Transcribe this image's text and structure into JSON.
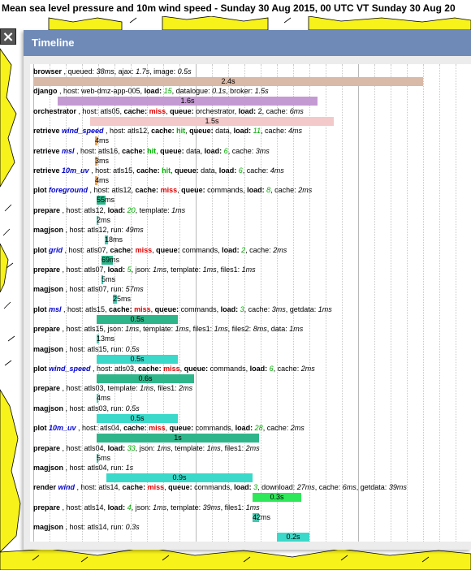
{
  "window_title": "Mean sea level pressure and 10m wind speed - Sunday 30 Aug 2015, 00 UTC VT Sunday 30 Aug 20",
  "close_label": "×",
  "panel": {
    "title": "Timeline"
  },
  "colors": {
    "header": "#6f8ab7",
    "browser_bar": "#d9b9a7",
    "django_bar": "#c49ad3",
    "orchestrator_bar": "#f4c9c9",
    "retrieve_bar": "#e8a35a",
    "plot_bar": "#2fb58a",
    "small_bar": "#45c9b0",
    "magjson_bar": "#3ad9c9",
    "render_bar": "#2ee85a",
    "miss": "#e00000",
    "hit": "#00b000",
    "name": "#0000cc"
  },
  "rows": [
    {
      "parts": [
        [
          "b",
          "browser"
        ],
        [
          "t",
          " ,  queued: "
        ],
        [
          "i",
          "38ms"
        ],
        [
          "t",
          ",  ajax: "
        ],
        [
          "i",
          "1.7s"
        ],
        [
          "t",
          ",  image: "
        ],
        [
          "i",
          "0.5s"
        ]
      ],
      "bar": {
        "start": 0.0,
        "dur": 2.4,
        "color": "browser_bar",
        "label": "2.4s"
      }
    },
    {
      "parts": [
        [
          "b",
          "django"
        ],
        [
          "t",
          " ,  host: web-dmz-app-005,  "
        ],
        [
          "b",
          "load: "
        ],
        [
          "l",
          "15"
        ],
        [
          "t",
          ",  datalogue: "
        ],
        [
          "i",
          "0.1s"
        ],
        [
          "t",
          ",  broker: "
        ],
        [
          "i",
          "1.5s"
        ]
      ],
      "bar": {
        "start": 0.15,
        "dur": 1.6,
        "color": "django_bar",
        "label": "1.6s"
      }
    },
    {
      "parts": [
        [
          "b",
          "orchestrator"
        ],
        [
          "t",
          " ,  host: atls05,  "
        ],
        [
          "b",
          "cache: "
        ],
        [
          "m",
          "miss"
        ],
        [
          "t",
          ",  "
        ],
        [
          "b",
          "queue: "
        ],
        [
          "t",
          "orchestrator,  "
        ],
        [
          "b",
          "load: "
        ],
        [
          "t",
          "2,  cache: "
        ],
        [
          "i",
          "6ms"
        ]
      ],
      "bar": {
        "start": 0.35,
        "dur": 1.5,
        "color": "orchestrator_bar",
        "label": "1.5s"
      }
    },
    {
      "parts": [
        [
          "b",
          "retrieve "
        ],
        [
          "n",
          "wind_speed"
        ],
        [
          "t",
          " ,  host: atls12,  "
        ],
        [
          "b",
          "cache: "
        ],
        [
          "h",
          "hit"
        ],
        [
          "t",
          ",  "
        ],
        [
          "b",
          "queue: "
        ],
        [
          "t",
          "data,  "
        ],
        [
          "b",
          "load: "
        ],
        [
          "l",
          "11"
        ],
        [
          "t",
          ",  cache: "
        ],
        [
          "i",
          "4ms"
        ]
      ],
      "bar": {
        "start": 0.38,
        "dur": 0.015,
        "color": "retrieve_bar",
        "label": "4ms"
      }
    },
    {
      "parts": [
        [
          "b",
          "retrieve "
        ],
        [
          "n",
          "msl"
        ],
        [
          "t",
          " ,  host: atls16,  "
        ],
        [
          "b",
          "cache: "
        ],
        [
          "h",
          "hit"
        ],
        [
          "t",
          ",  "
        ],
        [
          "b",
          "queue: "
        ],
        [
          "t",
          "data,  "
        ],
        [
          "b",
          "load: "
        ],
        [
          "l",
          "6"
        ],
        [
          "t",
          ",  cache: "
        ],
        [
          "i",
          "3ms"
        ]
      ],
      "bar": {
        "start": 0.38,
        "dur": 0.015,
        "color": "retrieve_bar",
        "label": "3ms"
      }
    },
    {
      "parts": [
        [
          "b",
          "retrieve "
        ],
        [
          "n",
          "10m_uv"
        ],
        [
          "t",
          " ,  host: atls15,  "
        ],
        [
          "b",
          "cache: "
        ],
        [
          "h",
          "hit"
        ],
        [
          "t",
          ",  "
        ],
        [
          "b",
          "queue: "
        ],
        [
          "t",
          "data,  "
        ],
        [
          "b",
          "load: "
        ],
        [
          "l",
          "6"
        ],
        [
          "t",
          ",  cache: "
        ],
        [
          "i",
          "4ms"
        ]
      ],
      "bar": {
        "start": 0.38,
        "dur": 0.015,
        "color": "retrieve_bar",
        "label": "4ms"
      }
    },
    {
      "parts": [
        [
          "b",
          "plot "
        ],
        [
          "n",
          "foreground"
        ],
        [
          "t",
          " ,  host: atls12,  "
        ],
        [
          "b",
          "cache: "
        ],
        [
          "m",
          "miss"
        ],
        [
          "t",
          ",  "
        ],
        [
          "b",
          "queue: "
        ],
        [
          "t",
          "commands,  "
        ],
        [
          "b",
          "load: "
        ],
        [
          "l",
          "8"
        ],
        [
          "t",
          ",  cache: "
        ],
        [
          "i",
          "2ms"
        ]
      ],
      "bar": {
        "start": 0.39,
        "dur": 0.055,
        "color": "plot_bar",
        "label": "55ms"
      }
    },
    {
      "parts": [
        [
          "b",
          "prepare"
        ],
        [
          "t",
          " ,  host: atls12,  "
        ],
        [
          "b",
          "load: "
        ],
        [
          "l",
          "20"
        ],
        [
          "t",
          ",  template: "
        ],
        [
          "i",
          "1ms"
        ]
      ],
      "bar": {
        "start": 0.39,
        "dur": 0.002,
        "color": "small_bar",
        "label": "2ms"
      }
    },
    {
      "parts": [
        [
          "b",
          "magjson"
        ],
        [
          "t",
          " ,  host: atls12,  run: "
        ],
        [
          "i",
          "49ms"
        ]
      ],
      "bar": {
        "start": 0.44,
        "dur": 0.018,
        "color": "small_bar",
        "label": "18ms"
      }
    },
    {
      "parts": [
        [
          "b",
          "plot "
        ],
        [
          "n",
          "grid"
        ],
        [
          "t",
          " ,  host: atls07,  "
        ],
        [
          "b",
          "cache: "
        ],
        [
          "m",
          "miss"
        ],
        [
          "t",
          ",  "
        ],
        [
          "b",
          "queue: "
        ],
        [
          "t",
          "commands,  "
        ],
        [
          "b",
          "load: "
        ],
        [
          "l",
          "2"
        ],
        [
          "t",
          ",  cache: "
        ],
        [
          "i",
          "2ms"
        ]
      ],
      "bar": {
        "start": 0.42,
        "dur": 0.069,
        "color": "plot_bar",
        "label": "69ms"
      }
    },
    {
      "parts": [
        [
          "b",
          "prepare"
        ],
        [
          "t",
          " ,  host: atls07,  "
        ],
        [
          "b",
          "load: "
        ],
        [
          "l",
          "5"
        ],
        [
          "t",
          ",  json: "
        ],
        [
          "i",
          "1ms"
        ],
        [
          "t",
          ",  template: "
        ],
        [
          "i",
          "1ms"
        ],
        [
          "t",
          ",  files1: "
        ],
        [
          "i",
          "1ms"
        ]
      ],
      "bar": {
        "start": 0.42,
        "dur": 0.005,
        "color": "small_bar",
        "label": "5ms"
      }
    },
    {
      "parts": [
        [
          "b",
          "magjson"
        ],
        [
          "t",
          " ,  host: atls07,  run: "
        ],
        [
          "i",
          "57ms"
        ]
      ],
      "bar": {
        "start": 0.49,
        "dur": 0.025,
        "color": "small_bar",
        "label": "25ms"
      }
    },
    {
      "parts": [
        [
          "b",
          "plot "
        ],
        [
          "n",
          "msl"
        ],
        [
          "t",
          " ,  host: atls15,  "
        ],
        [
          "b",
          "cache: "
        ],
        [
          "m",
          "miss"
        ],
        [
          "t",
          ",  "
        ],
        [
          "b",
          "queue: "
        ],
        [
          "t",
          "commands,  "
        ],
        [
          "b",
          "load: "
        ],
        [
          "l",
          "3"
        ],
        [
          "t",
          ",  cache: "
        ],
        [
          "i",
          "3ms"
        ],
        [
          "t",
          ",  getdata: "
        ],
        [
          "i",
          "1ms"
        ]
      ],
      "bar": {
        "start": 0.39,
        "dur": 0.5,
        "color": "plot_bar",
        "label": "0.5s"
      }
    },
    {
      "parts": [
        [
          "b",
          "prepare"
        ],
        [
          "t",
          " ,  host: atls15,  json: "
        ],
        [
          "i",
          "1ms"
        ],
        [
          "t",
          ",  template: "
        ],
        [
          "i",
          "1ms"
        ],
        [
          "t",
          ",  files1: "
        ],
        [
          "i",
          "1ms"
        ],
        [
          "t",
          ",  files2: "
        ],
        [
          "i",
          "8ms"
        ],
        [
          "t",
          ",  data: "
        ],
        [
          "i",
          "1ms"
        ]
      ],
      "bar": {
        "start": 0.39,
        "dur": 0.013,
        "color": "small_bar",
        "label": "13ms"
      }
    },
    {
      "parts": [
        [
          "b",
          "magjson"
        ],
        [
          "t",
          " ,  host: atls15,  run: "
        ],
        [
          "i",
          "0.5s"
        ]
      ],
      "bar": {
        "start": 0.39,
        "dur": 0.5,
        "color": "magjson_bar",
        "label": "0.5s"
      }
    },
    {
      "parts": [
        [
          "b",
          "plot "
        ],
        [
          "n",
          "wind_speed"
        ],
        [
          "t",
          " ,  host: atls03,  "
        ],
        [
          "b",
          "cache: "
        ],
        [
          "m",
          "miss"
        ],
        [
          "t",
          ",  "
        ],
        [
          "b",
          "queue: "
        ],
        [
          "t",
          "commands,  "
        ],
        [
          "b",
          "load: "
        ],
        [
          "l",
          "6"
        ],
        [
          "t",
          ",  cache: "
        ],
        [
          "i",
          "2ms"
        ]
      ],
      "bar": {
        "start": 0.39,
        "dur": 0.6,
        "color": "plot_bar",
        "label": "0.6s"
      }
    },
    {
      "parts": [
        [
          "b",
          "prepare"
        ],
        [
          "t",
          " ,  host: atls03,  template: "
        ],
        [
          "i",
          "1ms"
        ],
        [
          "t",
          ",  files1: "
        ],
        [
          "i",
          "2ms"
        ]
      ],
      "bar": {
        "start": 0.39,
        "dur": 0.004,
        "color": "small_bar",
        "label": "4ms"
      }
    },
    {
      "parts": [
        [
          "b",
          "magjson"
        ],
        [
          "t",
          " ,  host: atls03,  run: "
        ],
        [
          "i",
          "0.5s"
        ]
      ],
      "bar": {
        "start": 0.39,
        "dur": 0.5,
        "color": "magjson_bar",
        "label": "0.5s"
      }
    },
    {
      "parts": [
        [
          "b",
          "plot "
        ],
        [
          "n",
          "10m_uv"
        ],
        [
          "t",
          " ,  host: atls04,  "
        ],
        [
          "b",
          "cache: "
        ],
        [
          "m",
          "miss"
        ],
        [
          "t",
          ",  "
        ],
        [
          "b",
          "queue: "
        ],
        [
          "t",
          "commands,  "
        ],
        [
          "b",
          "load: "
        ],
        [
          "l",
          "28"
        ],
        [
          "t",
          ",  cache: "
        ],
        [
          "i",
          "2ms"
        ]
      ],
      "bar": {
        "start": 0.39,
        "dur": 1.0,
        "color": "plot_bar",
        "label": "1s"
      }
    },
    {
      "parts": [
        [
          "b",
          "prepare"
        ],
        [
          "t",
          " ,  host: atls04,  "
        ],
        [
          "b",
          "load: "
        ],
        [
          "l",
          "33"
        ],
        [
          "t",
          ",  json: "
        ],
        [
          "i",
          "1ms"
        ],
        [
          "t",
          ",  template: "
        ],
        [
          "i",
          "1ms"
        ],
        [
          "t",
          ",  files1: "
        ],
        [
          "i",
          "2ms"
        ]
      ],
      "bar": {
        "start": 0.39,
        "dur": 0.005,
        "color": "small_bar",
        "label": "5ms"
      }
    },
    {
      "parts": [
        [
          "b",
          "magjson"
        ],
        [
          "t",
          " ,  host: atls04,  run: "
        ],
        [
          "i",
          "1s"
        ]
      ],
      "bar": {
        "start": 0.45,
        "dur": 0.9,
        "color": "magjson_bar",
        "label": "0.9s"
      }
    },
    {
      "parts": [
        [
          "b",
          "render "
        ],
        [
          "n",
          "wind"
        ],
        [
          "t",
          " ,  host: atls14,  "
        ],
        [
          "b",
          "cache: "
        ],
        [
          "m",
          "miss"
        ],
        [
          "t",
          ",  "
        ],
        [
          "b",
          "queue: "
        ],
        [
          "t",
          "commands,  "
        ],
        [
          "b",
          "load: "
        ],
        [
          "l",
          "3"
        ],
        [
          "t",
          ",  download: "
        ],
        [
          "i",
          "27ms"
        ],
        [
          "t",
          ",  cache: "
        ],
        [
          "i",
          "6ms"
        ],
        [
          "t",
          ",  getdata: "
        ],
        [
          "i",
          "39ms"
        ]
      ],
      "bar": {
        "start": 1.35,
        "dur": 0.3,
        "color": "render_bar",
        "label": "0.3s"
      }
    },
    {
      "parts": [
        [
          "b",
          "prepare"
        ],
        [
          "t",
          " ,  host: atls14,  "
        ],
        [
          "b",
          "load: "
        ],
        [
          "l",
          "4"
        ],
        [
          "t",
          ",  json: "
        ],
        [
          "i",
          "1ms"
        ],
        [
          "t",
          ",  template: "
        ],
        [
          "i",
          "39ms"
        ],
        [
          "t",
          ",  files1: "
        ],
        [
          "i",
          "1ms"
        ]
      ],
      "bar": {
        "start": 1.35,
        "dur": 0.042,
        "color": "small_bar",
        "label": "42ms"
      }
    },
    {
      "parts": [
        [
          "b",
          "magjson"
        ],
        [
          "t",
          " ,  host: atls14,  run: "
        ],
        [
          "i",
          "0.3s"
        ]
      ],
      "bar": {
        "start": 1.5,
        "dur": 0.2,
        "color": "magjson_bar",
        "label": "0.2s"
      }
    }
  ]
}
